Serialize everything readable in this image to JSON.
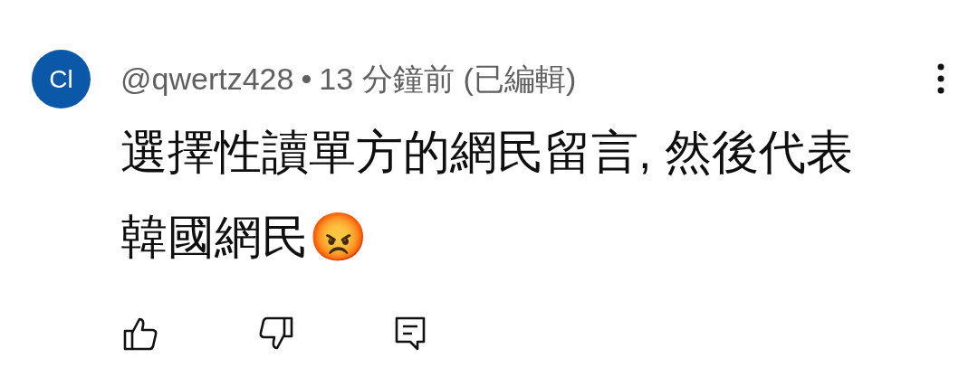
{
  "comment": {
    "avatar": {
      "initials": "Cl",
      "color": "#0b57a8"
    },
    "author": "@qwertz428",
    "separator": "•",
    "time": "13 分鐘前",
    "edited_label": "(已編輯)",
    "text": "選擇性讀單方的網民留言, 然後代表韓國網民😡"
  }
}
